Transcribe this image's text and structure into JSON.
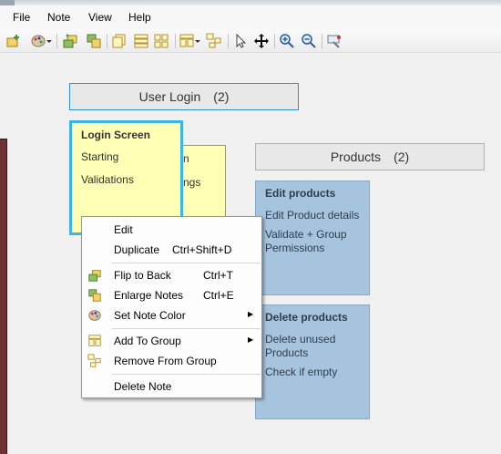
{
  "menubar": {
    "items": [
      "File",
      "Note",
      "View",
      "Help"
    ]
  },
  "toolbar": {
    "icons": [
      "new-note-icon",
      "color-palette-icon",
      "flip-to-back-icon",
      "enlarge-notes-icon",
      "copy-icon",
      "layout-rows-icon",
      "layout-grid-icon",
      "arrange-icon",
      "group-icon",
      "pointer-icon",
      "pan-icon",
      "zoom-in-icon",
      "zoom-out-icon",
      "magic-icon"
    ]
  },
  "groups": {
    "user_login": {
      "title": "User Login",
      "count": "(2)"
    },
    "products": {
      "title": "Products",
      "count": "(2)"
    }
  },
  "notes": {
    "login_screen": {
      "title": "Login Screen",
      "lines": [
        "Starting",
        "Validations"
      ]
    },
    "back_note": {
      "frag1": "n",
      "frag2": "ngs"
    },
    "edit_products": {
      "title": "Edit products",
      "lines": [
        "Edit Product details",
        "Validate + Group Permissions"
      ]
    },
    "delete_products": {
      "title": "Delete products",
      "lines": [
        "Delete unused Products",
        "Check if empty"
      ]
    }
  },
  "context_menu": {
    "items": [
      {
        "label": "Edit",
        "shortcut": ""
      },
      {
        "label": "Duplicate",
        "shortcut": "Ctrl+Shift+D"
      },
      {
        "label": "Flip to Back",
        "shortcut": "Ctrl+T"
      },
      {
        "label": "Enlarge Notes",
        "shortcut": "Ctrl+E"
      },
      {
        "label": "Set Note Color",
        "shortcut": ""
      },
      {
        "label": "Add To Group",
        "shortcut": ""
      },
      {
        "label": "Remove From Group",
        "shortcut": ""
      },
      {
        "label": "Delete Note",
        "shortcut": ""
      }
    ],
    "submenu_arrow": "▶"
  },
  "colors": {
    "note_yellow": "#ffffb5",
    "note_blue": "#a7c4de",
    "selection_border": "#3cb4e6",
    "frame": "#6e3132"
  }
}
